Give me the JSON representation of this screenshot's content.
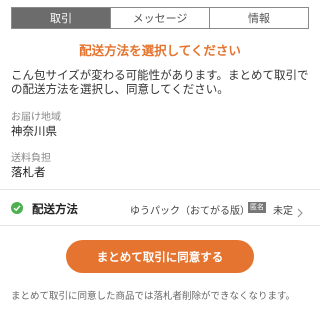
{
  "tabs": [
    {
      "label": "取引",
      "active": true
    },
    {
      "label": "メッセージ",
      "active": false
    },
    {
      "label": "情報",
      "active": false
    }
  ],
  "notice": "配送方法を選択してください",
  "description": "こん包サイズが変わる可能性があります。まとめて取引での配送方法を選択し、同意してください。",
  "delivery_area": {
    "label": "お届け地域",
    "value": "神奈川県"
  },
  "shipping_fee": {
    "label": "送料負担",
    "value": "落札者"
  },
  "shipping": {
    "label": "配送方法",
    "method": "ゆうパック（おてがる版）",
    "badge": "匿名",
    "status": "未定"
  },
  "agree_button": "まとめて取引に同意する",
  "footnote": "まとめて取引に同意した商品では落札者削除ができなくなります。",
  "colors": {
    "accent": "#e4742f",
    "check": "#4caf50",
    "active_tab": "#6c6c6c"
  }
}
